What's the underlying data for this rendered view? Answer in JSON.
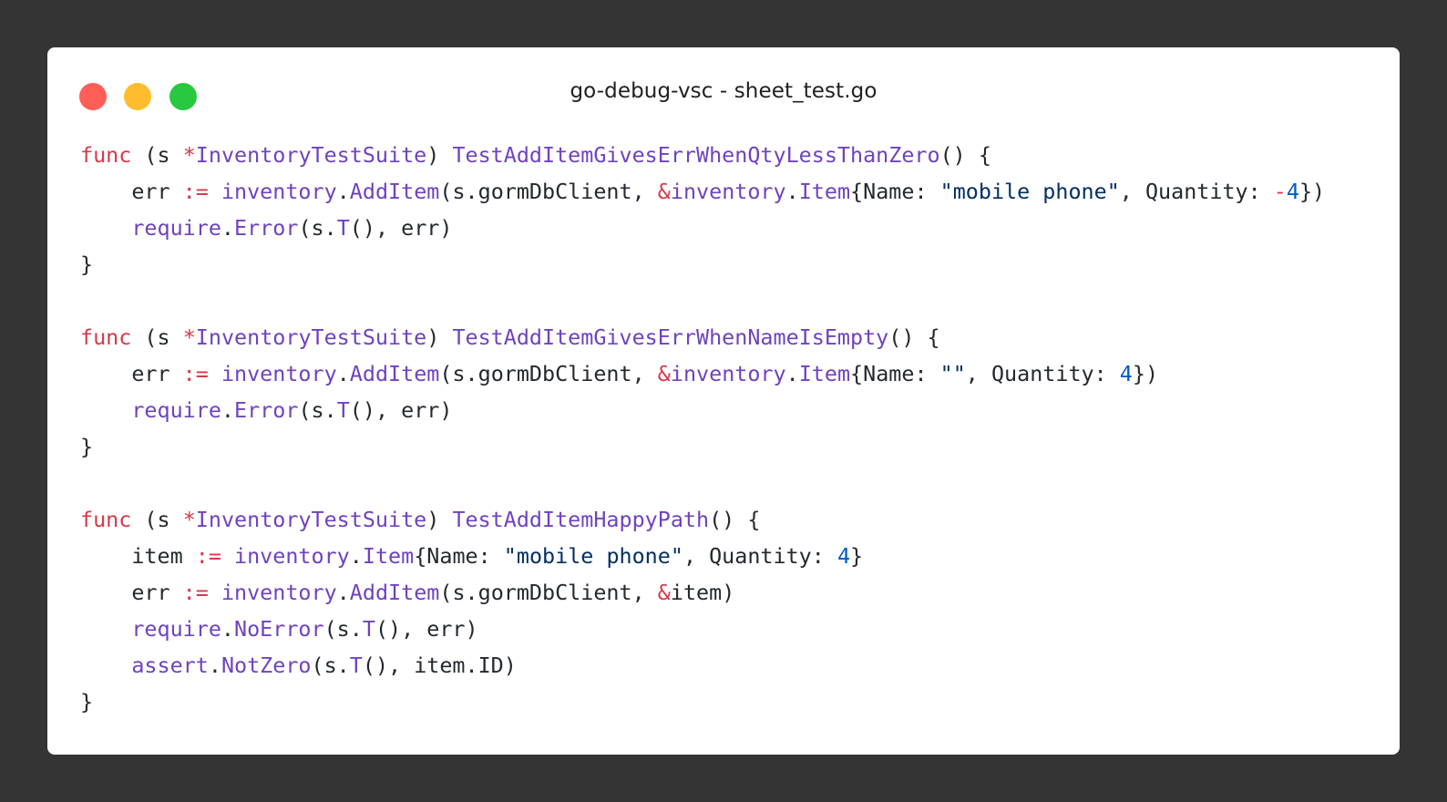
{
  "window": {
    "title": "go-debug-vsc - sheet_test.go",
    "controls": [
      {
        "name": "close",
        "color": "#ff5f57"
      },
      {
        "name": "minimize",
        "color": "#febc2e"
      },
      {
        "name": "zoom",
        "color": "#28c840"
      }
    ]
  },
  "colors": {
    "keyword": "#d73a49",
    "function": "#6f42c1",
    "string": "#032f62",
    "number": "#005cc5",
    "text": "#24292e"
  },
  "code": {
    "lines": [
      [
        [
          "kw",
          "func"
        ],
        [
          "p",
          " (s "
        ],
        [
          "op",
          "*"
        ],
        [
          "fn",
          "InventoryTestSuite"
        ],
        [
          "p",
          ") "
        ],
        [
          "fn",
          "TestAddItemGivesErrWhenQtyLessThanZero"
        ],
        [
          "p",
          "() {"
        ]
      ],
      [
        [
          "p",
          "    err "
        ],
        [
          "op",
          ":="
        ],
        [
          "p",
          " "
        ],
        [
          "fn",
          "inventory"
        ],
        [
          "p",
          "."
        ],
        [
          "fn",
          "AddItem"
        ],
        [
          "p",
          "(s.gormDbClient, "
        ],
        [
          "op",
          "&"
        ],
        [
          "fn",
          "inventory"
        ],
        [
          "p",
          "."
        ],
        [
          "fn",
          "Item"
        ],
        [
          "p",
          "{Name: "
        ],
        [
          "str",
          "\"mobile phone\""
        ],
        [
          "p",
          ", Quantity: "
        ],
        [
          "op",
          "-"
        ],
        [
          "num",
          "4"
        ],
        [
          "p",
          "})"
        ]
      ],
      [
        [
          "p",
          "    "
        ],
        [
          "fn",
          "require"
        ],
        [
          "p",
          "."
        ],
        [
          "fn",
          "Error"
        ],
        [
          "p",
          "(s."
        ],
        [
          "fn",
          "T"
        ],
        [
          "p",
          "(), err)"
        ]
      ],
      [
        [
          "p",
          "}"
        ]
      ],
      [
        [
          "p",
          ""
        ]
      ],
      [
        [
          "kw",
          "func"
        ],
        [
          "p",
          " (s "
        ],
        [
          "op",
          "*"
        ],
        [
          "fn",
          "InventoryTestSuite"
        ],
        [
          "p",
          ") "
        ],
        [
          "fn",
          "TestAddItemGivesErrWhenNameIsEmpty"
        ],
        [
          "p",
          "() {"
        ]
      ],
      [
        [
          "p",
          "    err "
        ],
        [
          "op",
          ":="
        ],
        [
          "p",
          " "
        ],
        [
          "fn",
          "inventory"
        ],
        [
          "p",
          "."
        ],
        [
          "fn",
          "AddItem"
        ],
        [
          "p",
          "(s.gormDbClient, "
        ],
        [
          "op",
          "&"
        ],
        [
          "fn",
          "inventory"
        ],
        [
          "p",
          "."
        ],
        [
          "fn",
          "Item"
        ],
        [
          "p",
          "{Name: "
        ],
        [
          "str",
          "\"\""
        ],
        [
          "p",
          ", Quantity: "
        ],
        [
          "num",
          "4"
        ],
        [
          "p",
          "})"
        ]
      ],
      [
        [
          "p",
          "    "
        ],
        [
          "fn",
          "require"
        ],
        [
          "p",
          "."
        ],
        [
          "fn",
          "Error"
        ],
        [
          "p",
          "(s."
        ],
        [
          "fn",
          "T"
        ],
        [
          "p",
          "(), err)"
        ]
      ],
      [
        [
          "p",
          "}"
        ]
      ],
      [
        [
          "p",
          ""
        ]
      ],
      [
        [
          "kw",
          "func"
        ],
        [
          "p",
          " (s "
        ],
        [
          "op",
          "*"
        ],
        [
          "fn",
          "InventoryTestSuite"
        ],
        [
          "p",
          ") "
        ],
        [
          "fn",
          "TestAddItemHappyPath"
        ],
        [
          "p",
          "() {"
        ]
      ],
      [
        [
          "p",
          "    item "
        ],
        [
          "op",
          ":="
        ],
        [
          "p",
          " "
        ],
        [
          "fn",
          "inventory"
        ],
        [
          "p",
          "."
        ],
        [
          "fn",
          "Item"
        ],
        [
          "p",
          "{Name: "
        ],
        [
          "str",
          "\"mobile phone\""
        ],
        [
          "p",
          ", Quantity: "
        ],
        [
          "num",
          "4"
        ],
        [
          "p",
          "}"
        ]
      ],
      [
        [
          "p",
          "    err "
        ],
        [
          "op",
          ":="
        ],
        [
          "p",
          " "
        ],
        [
          "fn",
          "inventory"
        ],
        [
          "p",
          "."
        ],
        [
          "fn",
          "AddItem"
        ],
        [
          "p",
          "(s.gormDbClient, "
        ],
        [
          "op",
          "&"
        ],
        [
          "p",
          "item)"
        ]
      ],
      [
        [
          "p",
          "    "
        ],
        [
          "fn",
          "require"
        ],
        [
          "p",
          "."
        ],
        [
          "fn",
          "NoError"
        ],
        [
          "p",
          "(s."
        ],
        [
          "fn",
          "T"
        ],
        [
          "p",
          "(), err)"
        ]
      ],
      [
        [
          "p",
          "    "
        ],
        [
          "fn",
          "assert"
        ],
        [
          "p",
          "."
        ],
        [
          "fn",
          "NotZero"
        ],
        [
          "p",
          "(s."
        ],
        [
          "fn",
          "T"
        ],
        [
          "p",
          "(), item.ID)"
        ]
      ],
      [
        [
          "p",
          "}"
        ]
      ]
    ]
  }
}
